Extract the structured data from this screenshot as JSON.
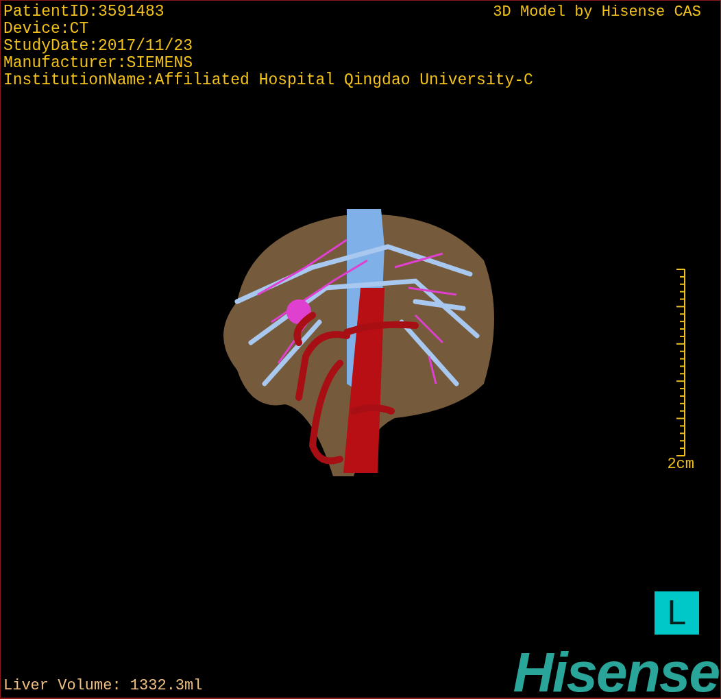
{
  "info_lines": [
    "PatientID:3591483",
    "Device:CT",
    "StudyDate:2017/11/23",
    "Manufacturer:SIEMENS",
    "InstitutionName:Affiliated Hospital Qingdao University-C"
  ],
  "credit": "3D Model by Hisense CAS",
  "scale_bar": {
    "label": "2cm"
  },
  "orientation_marker": "L",
  "liver_volume": "Liver Volume: 1332.3ml",
  "logo": "Hisense"
}
